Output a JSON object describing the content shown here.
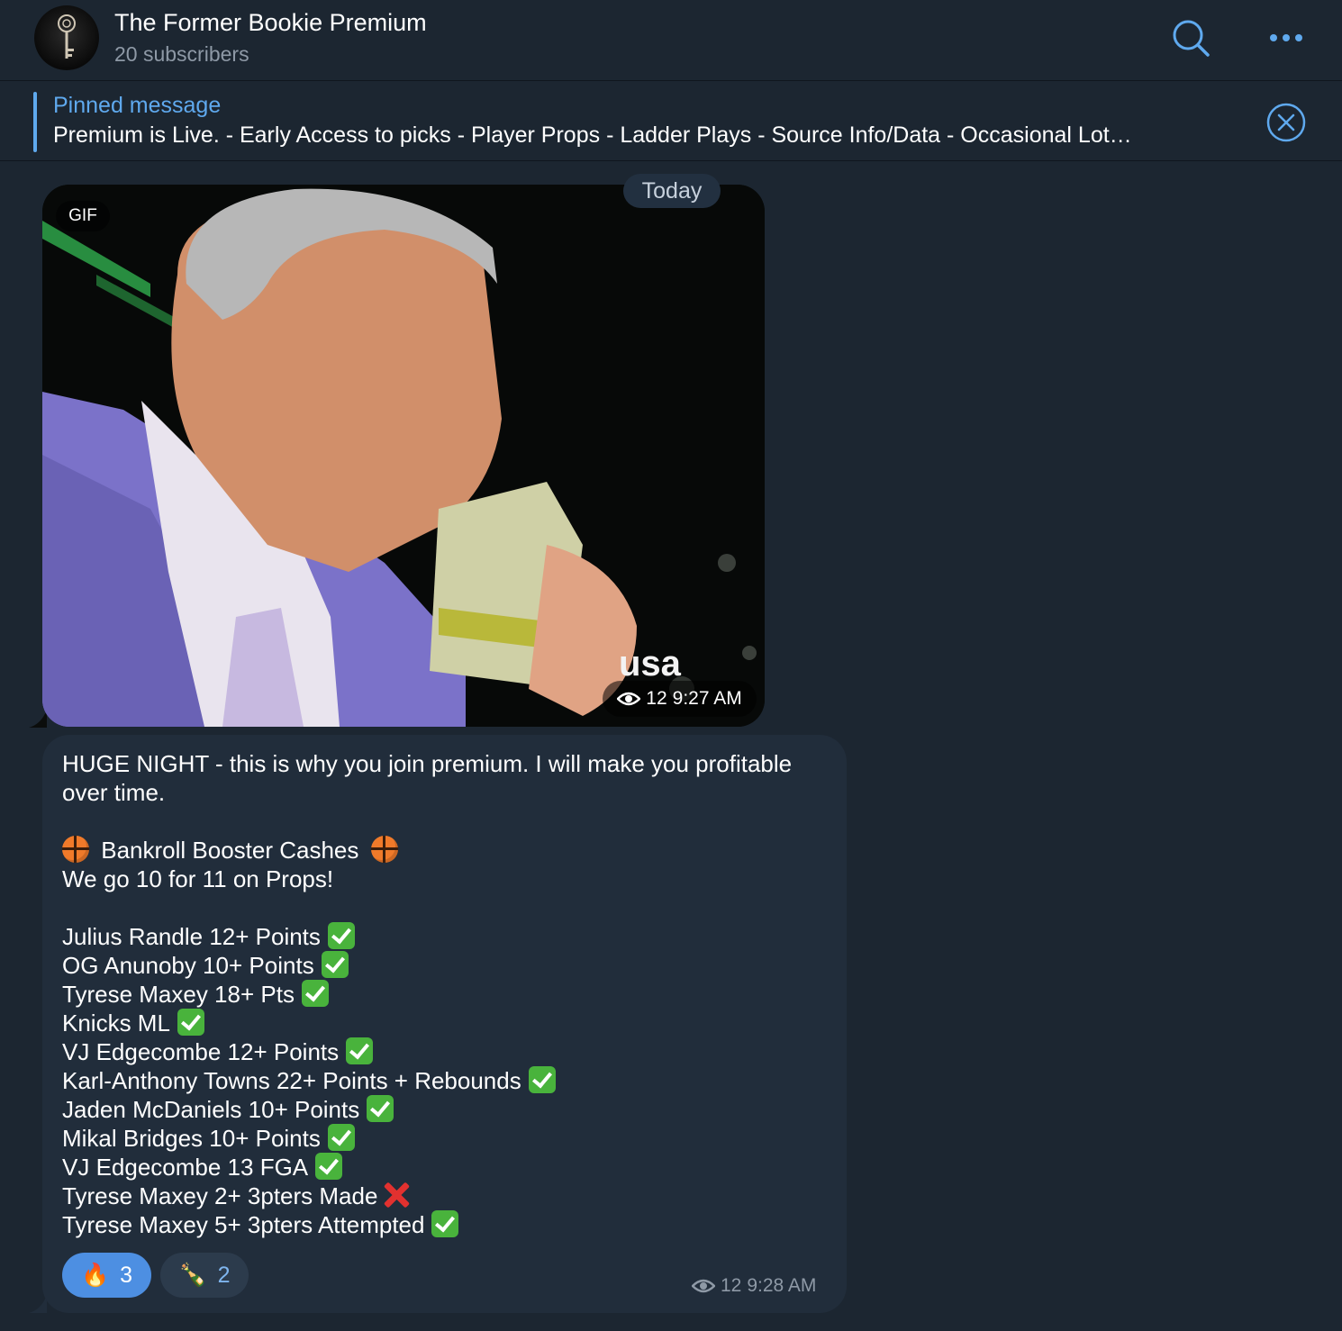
{
  "header": {
    "title": "The Former Bookie Premium",
    "subscribers": "20 subscribers",
    "icons": [
      "search-icon",
      "more-icon"
    ]
  },
  "pinned": {
    "label": "Pinned message",
    "text": "Premium is Live.  - Early Access to picks  - Player Props  - Ladder Plays  - Source Info/Data  - Occasional Lot…"
  },
  "chat": {
    "date": "Today",
    "gif": {
      "badge": "GIF",
      "views": "12",
      "time": "9:27 AM",
      "watermark": "usa"
    },
    "message": {
      "intro": "HUGE NIGHT -  this is why you join premium. I will make you profitable over time.",
      "heading": "Bankroll Booster Cashes",
      "summary": "We go 10 for 11 on Props!",
      "picks": [
        {
          "text": "Julius Randle 12+ Points",
          "result": "win"
        },
        {
          "text": "OG Anunoby 10+ Points",
          "result": "win"
        },
        {
          "text": "Tyrese Maxey 18+ Pts",
          "result": "win"
        },
        {
          "text": "Knicks ML",
          "result": "win"
        },
        {
          "text": "VJ Edgecombe 12+ Points",
          "result": "win"
        },
        {
          "text": "Karl-Anthony Towns 22+ Points + Rebounds",
          "result": "win"
        },
        {
          "text": "Jaden McDaniels 10+ Points",
          "result": "win"
        },
        {
          "text": "Mikal Bridges 10+ Points",
          "result": "win"
        },
        {
          "text": "VJ Edgecombe 13 FGA",
          "result": "win"
        },
        {
          "text": "Tyrese Maxey 2+ 3pters Made",
          "result": "loss"
        },
        {
          "text": "Tyrese Maxey 5+ 3pters Attempted",
          "result": "win"
        }
      ],
      "reactions": [
        {
          "emoji": "🔥",
          "count": "3"
        },
        {
          "emoji": "🍾",
          "count": "2"
        }
      ],
      "views": "12",
      "time": "9:28 AM"
    }
  },
  "colors": {
    "background": "#1c2631",
    "bubble": "#212d3b",
    "accent": "#5fa9ee",
    "check": "#49b33c",
    "cross": "#e2312f"
  }
}
